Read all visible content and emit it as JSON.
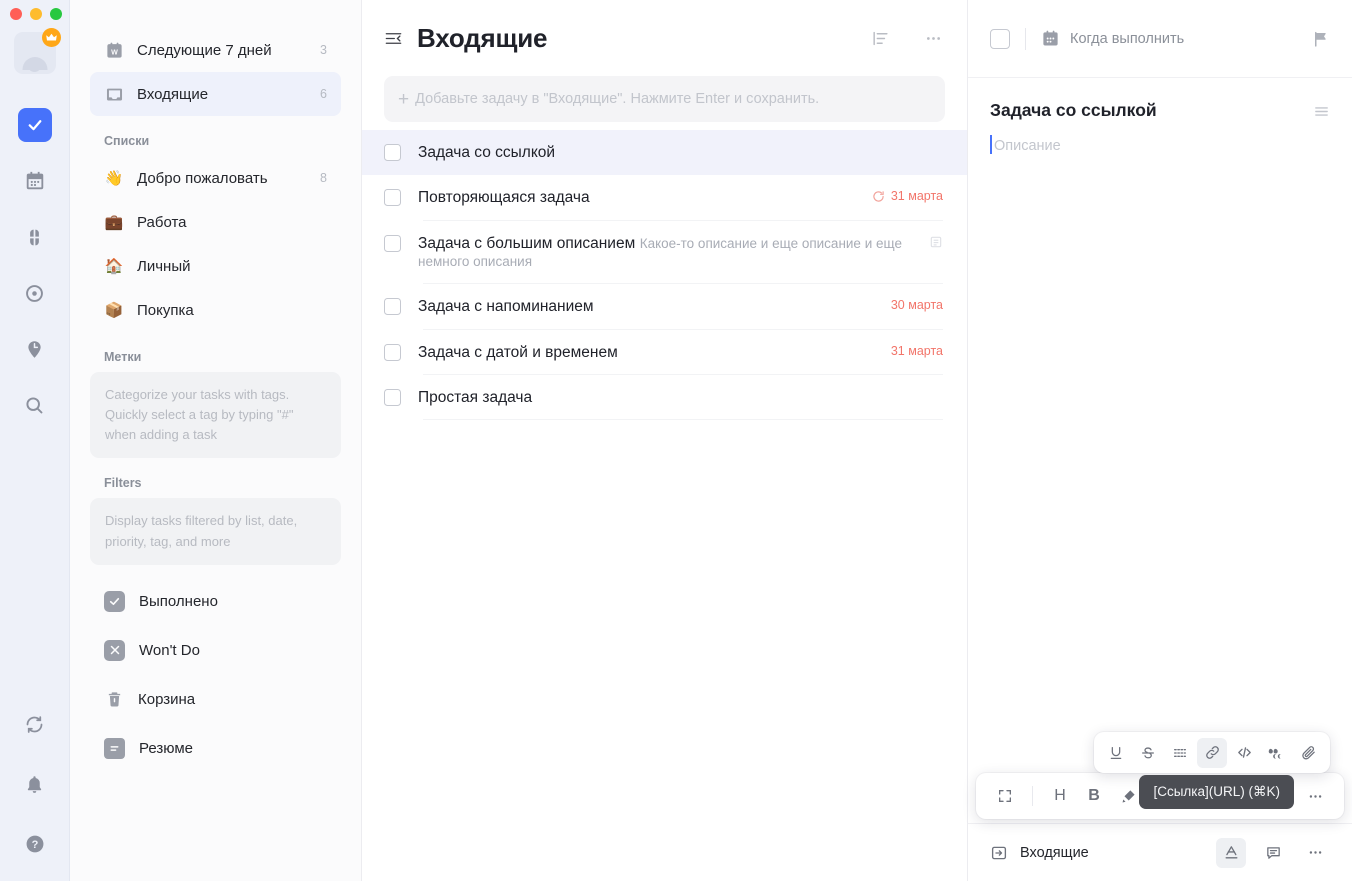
{
  "window": {
    "traffic_lights": [
      "close",
      "minimize",
      "zoom"
    ],
    "colors": {
      "accent": "#4772fa",
      "danger": "#f2756a",
      "crown": "#ffa717",
      "selected_row": "#f1f2fb"
    }
  },
  "rail": {
    "avatar": {
      "name": "user-avatar",
      "badge": "crown-badge"
    },
    "items": [
      {
        "icon": "check-square-icon",
        "name": "rail-item-tasks",
        "active": true
      },
      {
        "icon": "calendar-icon",
        "name": "rail-item-calendar",
        "active": false
      },
      {
        "icon": "four-squares-icon",
        "name": "rail-item-matrix",
        "active": false
      },
      {
        "icon": "target-icon",
        "name": "rail-item-habits",
        "active": false
      },
      {
        "icon": "pomodoro-clock-pin-icon",
        "name": "rail-item-pomodoro",
        "active": false
      },
      {
        "icon": "search-icon",
        "name": "rail-item-search",
        "active": false
      }
    ],
    "bottom_items": [
      {
        "icon": "sync-icon",
        "name": "rail-item-sync"
      },
      {
        "icon": "bell-icon",
        "name": "rail-item-notifications"
      },
      {
        "icon": "help-circle-icon",
        "name": "rail-item-help"
      }
    ]
  },
  "sidebar": {
    "smart_lists": [
      {
        "icon": "week-calendar-icon",
        "label": "Следующие 7 дней",
        "count": "3",
        "selected": false
      },
      {
        "icon": "inbox-tray-icon",
        "label": "Входящие",
        "count": "6",
        "selected": true
      }
    ],
    "lists_section": {
      "title": "Списки"
    },
    "lists": [
      {
        "emoji": "👋",
        "label": "Добро пожаловать",
        "count": "8"
      },
      {
        "emoji": "💼",
        "label": "Работа",
        "count": ""
      },
      {
        "emoji": "🏠",
        "label": "Личный",
        "count": ""
      },
      {
        "emoji": "📦",
        "label": "Покупка",
        "count": ""
      }
    ],
    "tags_section": {
      "title": "Метки",
      "hint": "Categorize your tasks with tags. Quickly select a tag by typing \"#\" when adding a task"
    },
    "filters_section": {
      "title": "Filters",
      "hint": "Display tasks filtered by list, date, priority, tag, and more"
    },
    "bottom_items": [
      {
        "icon": "check-icon",
        "label": "Выполнено"
      },
      {
        "icon": "x-icon",
        "label": "Won't Do"
      },
      {
        "icon": "trash-icon",
        "label": "Корзина"
      },
      {
        "icon": "summary-icon",
        "label": "Резюме"
      }
    ]
  },
  "center": {
    "title": "Входящие",
    "collapse_icon": "collapse-sidebar-icon",
    "sort_icon": "sort-list-icon",
    "more_icon": "more-horizontal-icon",
    "add_task": {
      "placeholder": "Добавьте задачу в \"Входящие\". Нажмите Enter и сохранить.",
      "plus": "+"
    },
    "tasks": [
      {
        "title": "Задача со ссылкой",
        "desc": "",
        "date": "",
        "selected": true,
        "repeat": false,
        "has_note": false
      },
      {
        "title": "Повторяющаяся задача",
        "desc": "",
        "date": "31 марта",
        "selected": false,
        "repeat": true,
        "has_note": false
      },
      {
        "title": "Задача с большим описанием",
        "desc": "Какое-то описание и еще описание и еще немного описания",
        "date": "",
        "selected": false,
        "repeat": false,
        "has_note": true
      },
      {
        "title": "Задача с напоминанием",
        "desc": "",
        "date": "30 марта",
        "selected": false,
        "repeat": false,
        "has_note": false
      },
      {
        "title": "Задача с датой и временем",
        "desc": "",
        "date": "31 марта",
        "selected": false,
        "repeat": false,
        "has_note": false
      },
      {
        "title": "Простая задача",
        "desc": "",
        "date": "",
        "selected": false,
        "repeat": false,
        "has_note": false
      }
    ]
  },
  "detail": {
    "checkbox": "task-complete-checkbox",
    "date_icon": "calendar-icon",
    "date_label": "Когда выполнить",
    "flag_icon": "priority-flag-icon",
    "title": "Задача со ссылкой",
    "lines_icon": "detail-menu-icon",
    "description_placeholder": "Описание",
    "format_toolbar_top": [
      {
        "name": "underline-button",
        "glyph": "U",
        "active": false
      },
      {
        "name": "strikethrough-button",
        "glyph": "S",
        "active": false
      },
      {
        "name": "divider-button",
        "glyph": "dashes",
        "active": false
      },
      {
        "name": "link-button",
        "glyph": "link",
        "active": true
      },
      {
        "name": "code-button",
        "glyph": "</>",
        "active": false
      },
      {
        "name": "quote-button",
        "glyph": "quotes",
        "active": false
      },
      {
        "name": "attachment-button",
        "glyph": "paperclip",
        "active": false
      }
    ],
    "format_toolbar_bottom": [
      {
        "name": "fullscreen-button",
        "glyph": "expand"
      },
      {
        "name": "heading-button",
        "glyph": "H"
      },
      {
        "name": "bold-button",
        "glyph": "B"
      },
      {
        "name": "highlight-button",
        "glyph": "pen"
      },
      {
        "name": "more-format-button",
        "glyph": "..."
      }
    ],
    "tooltip": "[Ссылка](URL) (⌘K)",
    "footer": {
      "project_icon": "move-to-list-icon",
      "project_label": "Входящие",
      "font_button": "text-format-button",
      "comment_button": "comment-button",
      "more_button": "more-horizontal-button"
    }
  }
}
